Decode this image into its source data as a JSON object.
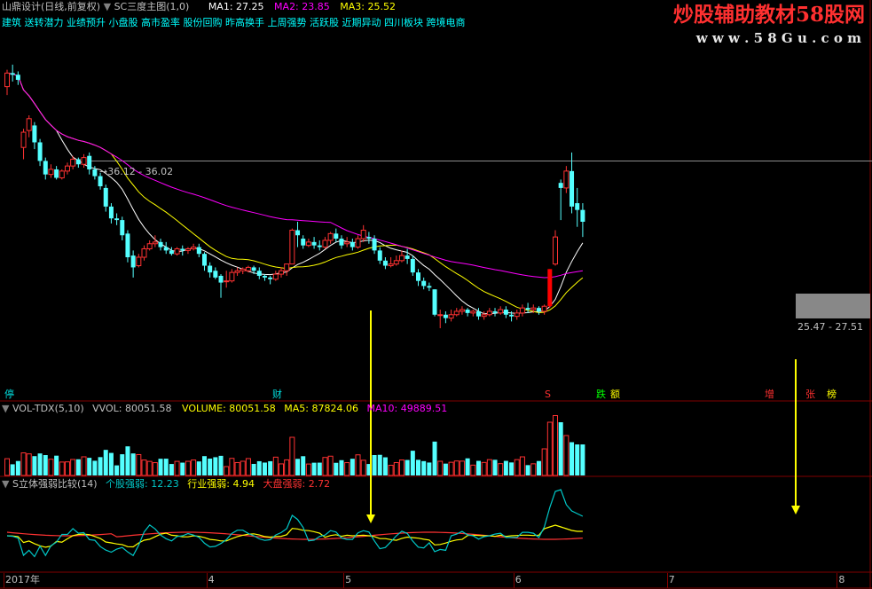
{
  "header": {
    "title": "山鼎设计(日线,前复权)",
    "indicator": "SC三度主图(1,0)",
    "ma1_label": "MA1:",
    "ma1_value": "27.25",
    "ma2_label": "MA2:",
    "ma2_value": "23.85",
    "ma3_label": "MA3:",
    "ma3_value": "25.52",
    "concepts": "建筑 送转潜力 业绩预升 小盘股 高市盈率 股份回购 昨高换手 上周强势 活跃股 近期异动 四川板块 跨境电商"
  },
  "watermark": {
    "line1": "炒股辅助教材58股网",
    "line2": "w w w . 5 8 G u . c o m"
  },
  "annotations": {
    "range_label": "36.12 - 36.02",
    "range_label2": "25.47 - 27.51"
  },
  "event_tags": [
    {
      "text": "停",
      "color": "#00e0e0"
    },
    {
      "text": "财",
      "color": "#00e0e0"
    },
    {
      "text": "S",
      "color": "#ff3030"
    },
    {
      "text": "跌",
      "color": "#00ff00"
    },
    {
      "text": "额",
      "color": "#ffff00"
    },
    {
      "text": "增",
      "color": "#ff3030"
    },
    {
      "text": "张",
      "color": "#ff3030"
    },
    {
      "text": "榜",
      "color": "#ffff00"
    }
  ],
  "vol_panel": {
    "name": "VOL-TDX(5,10)",
    "vvol": "VVOL: 80051.58",
    "volume_label": "VOLUME:",
    "volume_value": "80051.58",
    "ma5_label": "MA5:",
    "ma5_value": "87824.06",
    "ma10_label": "MA10:",
    "ma10_value": "49889.51"
  },
  "strength_panel": {
    "name": "S立体强弱比较(14)",
    "stock_label": "个股强弱:",
    "stock_value": "12.23",
    "industry_label": "行业强弱:",
    "industry_value": "4.94",
    "market_label": "大盘强弱:",
    "market_value": "2.72"
  },
  "x_axis": {
    "labels": [
      {
        "text": "2017年",
        "index": 0
      },
      {
        "text": "4",
        "index": 37
      },
      {
        "text": "5",
        "index": 62
      },
      {
        "text": "6",
        "index": 93
      },
      {
        "text": "7",
        "index": 121
      },
      {
        "text": "8",
        "index": 152
      }
    ]
  },
  "colors": {
    "up": "#ff3232",
    "down": "#54ffff",
    "limit_up": "#ff0000",
    "limit_down": "#00ff00",
    "ma1": "#ffffff",
    "ma2": "#ffff00",
    "ma3": "#ff00ff",
    "grid": "#800000",
    "stock": "#00c8c8",
    "industry": "#ffff00",
    "market": "#ff3232"
  },
  "chart_data": {
    "type": "candlestick",
    "title": "山鼎设计(日线,前复权)",
    "ylim": [
      22,
      43
    ],
    "candles": [
      [
        40.5,
        41.3,
        40.0,
        41.5
      ],
      [
        41.3,
        41.2,
        40.8,
        41.8
      ],
      [
        41.2,
        40.9,
        40.6,
        41.4
      ],
      [
        36.9,
        37.8,
        36.2,
        38.0
      ],
      [
        37.9,
        38.6,
        37.5,
        38.8
      ],
      [
        38.2,
        37.2,
        36.8,
        38.4
      ],
      [
        37.2,
        36.1,
        35.8,
        37.4
      ],
      [
        36.1,
        35.3,
        35.0,
        36.3
      ],
      [
        35.3,
        35.6,
        35.1,
        35.9
      ],
      [
        35.6,
        35.1,
        35.0,
        35.8
      ],
      [
        35.1,
        35.5,
        35.0,
        35.6
      ],
      [
        35.5,
        35.8,
        35.3,
        36.0
      ],
      [
        35.8,
        36.2,
        35.6,
        36.4
      ],
      [
        36.2,
        35.9,
        35.7,
        36.3
      ],
      [
        35.9,
        36.3,
        35.7,
        36.5
      ],
      [
        36.4,
        35.6,
        35.3,
        36.6
      ],
      [
        35.6,
        35.2,
        35.0,
        35.8
      ],
      [
        35.2,
        34.6,
        34.4,
        35.4
      ],
      [
        34.5,
        33.4,
        33.1,
        34.7
      ],
      [
        33.4,
        32.7,
        32.4,
        33.6
      ],
      [
        32.7,
        32.6,
        32.3,
        33.0
      ],
      [
        32.6,
        31.7,
        31.4,
        32.8
      ],
      [
        31.8,
        30.4,
        30.1,
        32.0
      ],
      [
        30.5,
        29.8,
        29.2,
        30.8
      ],
      [
        29.9,
        30.4,
        29.8,
        30.6
      ],
      [
        30.4,
        30.9,
        30.2,
        31.1
      ],
      [
        30.9,
        31.2,
        30.8,
        31.4
      ],
      [
        31.2,
        31.3,
        31.0,
        31.7
      ],
      [
        31.3,
        31.0,
        30.8,
        31.5
      ],
      [
        31.0,
        30.8,
        30.6,
        31.3
      ],
      [
        30.8,
        30.6,
        30.5,
        31.0
      ],
      [
        30.6,
        30.9,
        30.5,
        31.0
      ],
      [
        30.9,
        30.8,
        30.5,
        31.1
      ],
      [
        30.8,
        30.9,
        30.6,
        31.0
      ],
      [
        30.9,
        31.0,
        30.8,
        31.2
      ],
      [
        31.0,
        30.6,
        30.4,
        31.2
      ],
      [
        30.6,
        29.9,
        29.6,
        30.7
      ],
      [
        29.9,
        29.5,
        29.2,
        30.1
      ],
      [
        29.6,
        29.2,
        29.1,
        29.8
      ],
      [
        29.3,
        28.9,
        28.0,
        29.4
      ],
      [
        29.0,
        29.0,
        28.6,
        29.6
      ],
      [
        29.0,
        29.5,
        28.9,
        29.7
      ],
      [
        29.5,
        29.6,
        29.3,
        29.8
      ],
      [
        29.6,
        29.7,
        29.4,
        29.8
      ],
      [
        29.6,
        29.8,
        29.5,
        29.9
      ],
      [
        29.8,
        29.6,
        29.4,
        29.9
      ],
      [
        29.6,
        29.3,
        29.1,
        29.8
      ],
      [
        29.3,
        29.2,
        29.0,
        29.4
      ],
      [
        29.2,
        29.1,
        28.8,
        29.3
      ],
      [
        29.1,
        29.4,
        29.0,
        29.6
      ],
      [
        29.4,
        29.6,
        29.2,
        29.8
      ],
      [
        29.6,
        30.0,
        29.3,
        30.0
      ],
      [
        30.0,
        32.0,
        30.0,
        32.1
      ],
      [
        32.0,
        31.7,
        31.0,
        32.5
      ],
      [
        31.5,
        31.1,
        30.9,
        31.7
      ],
      [
        31.1,
        31.3,
        31.0,
        31.5
      ],
      [
        31.3,
        31.1,
        30.9,
        31.6
      ],
      [
        31.1,
        31.0,
        30.8,
        31.4
      ],
      [
        31.0,
        31.4,
        30.9,
        31.6
      ],
      [
        31.4,
        31.8,
        31.2,
        31.9
      ],
      [
        31.8,
        31.5,
        31.3,
        32.1
      ],
      [
        31.5,
        31.1,
        30.9,
        31.7
      ],
      [
        31.2,
        31.3,
        31.0,
        31.6
      ],
      [
        31.3,
        31.0,
        30.8,
        31.5
      ],
      [
        31.0,
        31.5,
        30.9,
        31.7
      ],
      [
        31.5,
        32.0,
        31.3,
        32.3
      ],
      [
        31.6,
        31.5,
        31.2,
        31.9
      ],
      [
        31.5,
        30.8,
        30.6,
        31.7
      ],
      [
        30.8,
        30.2,
        30.0,
        31.0
      ],
      [
        30.2,
        29.9,
        29.7,
        30.4
      ],
      [
        29.9,
        30.0,
        29.8,
        30.4
      ],
      [
        30.0,
        30.2,
        29.9,
        30.5
      ],
      [
        30.2,
        30.5,
        30.1,
        30.8
      ],
      [
        30.5,
        30.3,
        30.0,
        30.9
      ],
      [
        30.3,
        29.5,
        29.3,
        30.5
      ],
      [
        29.5,
        29.0,
        28.7,
        29.7
      ],
      [
        29.0,
        28.7,
        28.5,
        29.2
      ],
      [
        28.7,
        28.6,
        28.4,
        28.9
      ],
      [
        28.5,
        27.0,
        26.9,
        28.5
      ],
      [
        27.0,
        27.0,
        26.2,
        27.3
      ],
      [
        27.0,
        26.8,
        26.5,
        27.2
      ],
      [
        26.8,
        27.0,
        26.6,
        27.3
      ],
      [
        27.0,
        27.2,
        26.9,
        27.4
      ],
      [
        27.2,
        27.3,
        27.0,
        27.5
      ],
      [
        27.3,
        27.1,
        26.9,
        27.4
      ],
      [
        27.1,
        27.2,
        26.9,
        27.3
      ],
      [
        27.2,
        26.9,
        26.7,
        27.4
      ],
      [
        26.9,
        27.0,
        26.7,
        27.2
      ],
      [
        27.0,
        27.2,
        26.9,
        27.4
      ],
      [
        27.2,
        27.1,
        26.9,
        27.4
      ],
      [
        27.1,
        27.3,
        27.0,
        27.5
      ],
      [
        27.3,
        27.0,
        26.8,
        27.5
      ],
      [
        27.0,
        26.9,
        26.6,
        27.2
      ],
      [
        26.9,
        27.1,
        26.7,
        27.3
      ],
      [
        27.1,
        27.4,
        26.9,
        27.6
      ],
      [
        27.4,
        27.3,
        27.1,
        27.7
      ],
      [
        27.3,
        27.4,
        27.1,
        27.6
      ],
      [
        27.4,
        27.2,
        27.0,
        27.5
      ],
      [
        27.2,
        27.5,
        27.0,
        27.6
      ],
      [
        27.5,
        29.7,
        27.4,
        29.7
      ],
      [
        30.0,
        31.6,
        29.9,
        32.0
      ],
      [
        34.8,
        34.5,
        32.6,
        35.0
      ],
      [
        34.5,
        35.5,
        34.2,
        35.8
      ],
      [
        35.5,
        33.4,
        33.0,
        36.6
      ],
      [
        33.6,
        33.2,
        32.2,
        34.5
      ],
      [
        33.2,
        32.5,
        31.6,
        33.6
      ]
    ]
  }
}
